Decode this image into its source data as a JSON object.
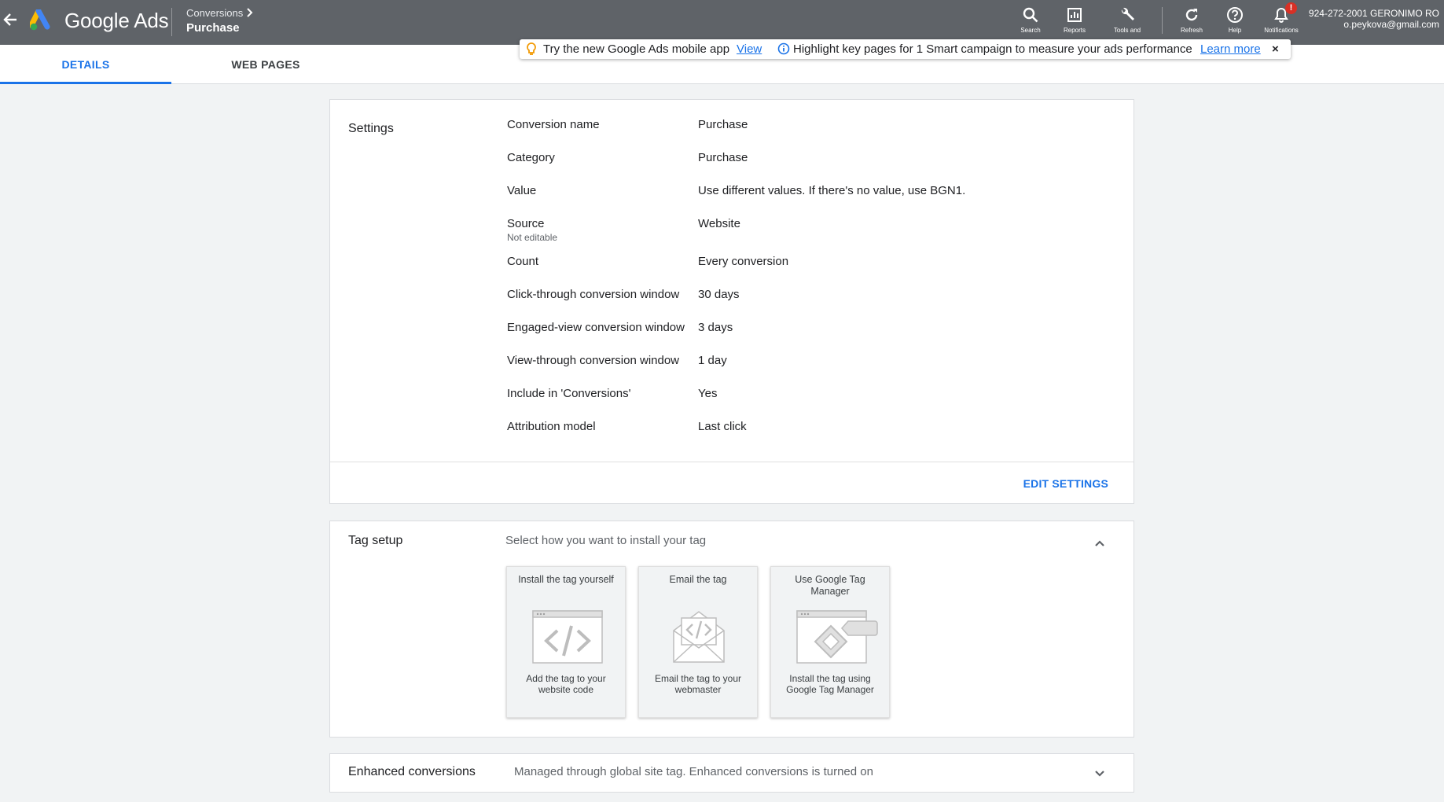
{
  "app": {
    "brand": "Google Ads"
  },
  "breadcrumb": {
    "parent": "Conversions",
    "current": "Purchase"
  },
  "toolbar": {
    "search": "Search",
    "reports": "Reports",
    "tools": "Tools and",
    "refresh": "Refresh",
    "help": "Help",
    "notifications": "Notifications",
    "notification_badge": "!"
  },
  "account": {
    "line1": "924-272-2001 GERONIMO RO",
    "line2": "o.peykova@gmail.com"
  },
  "notice": {
    "text1": "Try the new Google Ads mobile app",
    "link1": "View",
    "text2": "Highlight key pages for 1 Smart campaign to measure your ads performance",
    "link2": "Learn more",
    "close": "×"
  },
  "tabs": {
    "details": "DETAILS",
    "web_pages": "WEB PAGES"
  },
  "settings": {
    "title": "Settings",
    "rows": [
      {
        "label": "Conversion name",
        "value": "Purchase"
      },
      {
        "label": "Category",
        "value": "Purchase"
      },
      {
        "label": "Value",
        "value": "Use different values. If there's no value, use BGN1."
      },
      {
        "label": "Source",
        "value": "Website",
        "note": "Not editable"
      },
      {
        "label": "Count",
        "value": "Every conversion"
      },
      {
        "label": "Click-through conversion window",
        "value": "30 days"
      },
      {
        "label": "Engaged-view conversion window",
        "value": "3 days"
      },
      {
        "label": "View-through conversion window",
        "value": "1 day"
      },
      {
        "label": "Include in 'Conversions'",
        "value": "Yes"
      },
      {
        "label": "Attribution model",
        "value": "Last click"
      }
    ],
    "edit_button": "EDIT SETTINGS"
  },
  "tag_setup": {
    "title": "Tag setup",
    "subtitle": "Select how you want to install your tag",
    "options": [
      {
        "title": "Install the tag yourself",
        "description": "Add the tag to your website code",
        "icon": "code-window-icon"
      },
      {
        "title": "Email the tag",
        "description": "Email the tag to your webmaster",
        "icon": "email-code-icon"
      },
      {
        "title": "Use Google Tag Manager",
        "description": "Install the tag using Google Tag Manager",
        "icon": "tag-manager-icon"
      }
    ]
  },
  "enhanced": {
    "title": "Enhanced conversions",
    "subtitle": "Managed through global site tag. Enhanced conversions is turned on"
  },
  "colors": {
    "topbar": "#5f6368",
    "accent": "#1a73e8",
    "badge": "#d93025",
    "background": "#f1f3f4"
  }
}
